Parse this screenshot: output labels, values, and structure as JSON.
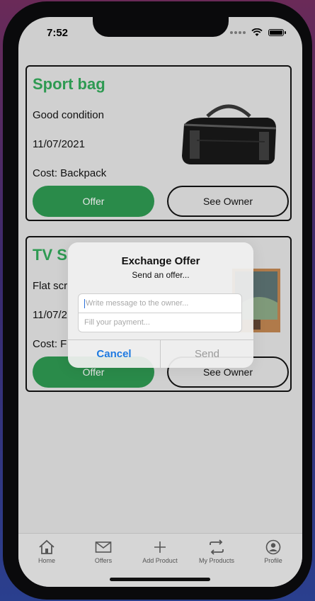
{
  "status": {
    "time": "7:52"
  },
  "products": [
    {
      "title": "Sport bag",
      "description": "Good condition",
      "date": "11/07/2021",
      "cost": "Cost: Backpack",
      "offer_label": "Offer",
      "owner_label": "See Owner"
    },
    {
      "title": "TV S",
      "description": "Flat scr",
      "date": "11/07/2",
      "cost": "Cost: F",
      "offer_label": "Offer",
      "owner_label": "See Owner"
    }
  ],
  "dialog": {
    "title": "Exchange Offer",
    "message": "Send an offer...",
    "message_placeholder": "Write message to the owner...",
    "payment_placeholder": "Fill your payment...",
    "cancel_label": "Cancel",
    "send_label": "Send"
  },
  "tabbar": {
    "items": [
      {
        "label": "Home",
        "icon": "home-icon"
      },
      {
        "label": "Offers",
        "icon": "envelope-icon"
      },
      {
        "label": "Add Product",
        "icon": "plus-icon"
      },
      {
        "label": "My Products",
        "icon": "swap-icon"
      },
      {
        "label": "Profile",
        "icon": "profile-icon"
      }
    ]
  },
  "colors": {
    "accent_green": "#2e9a52",
    "button_green": "#2a8b4a",
    "ios_blue": "#1d7ae0"
  }
}
